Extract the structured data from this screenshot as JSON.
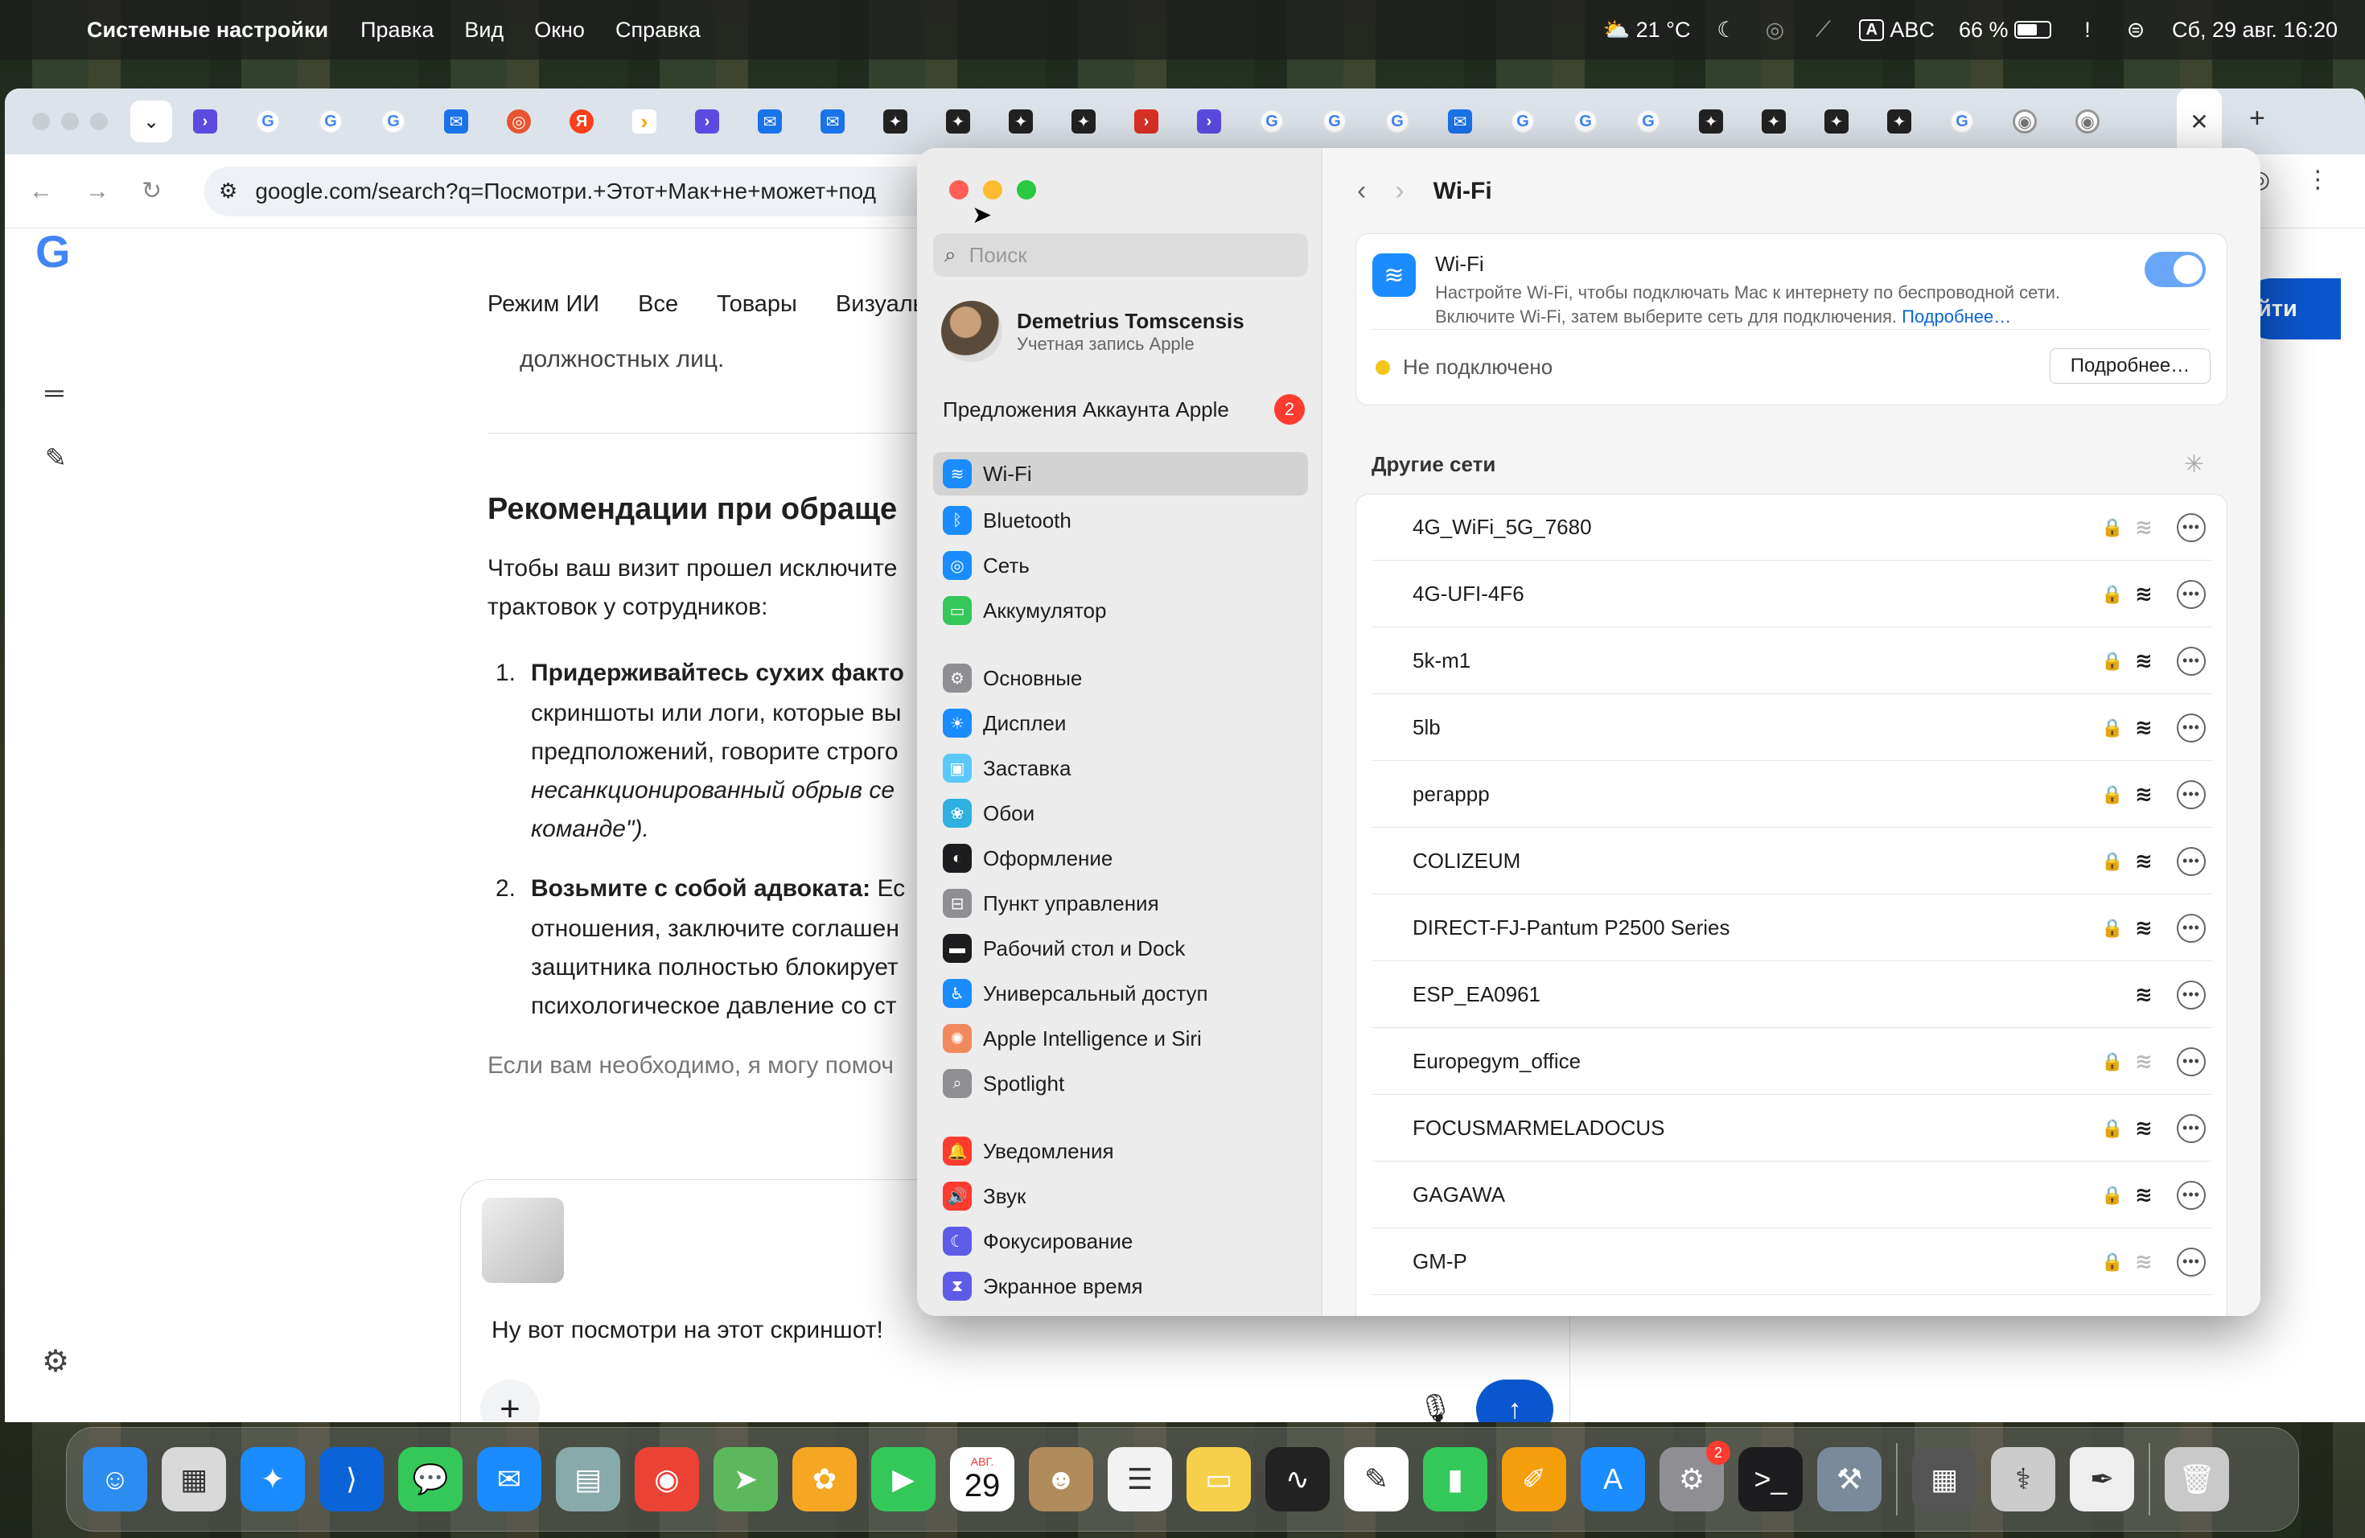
{
  "menubar": {
    "app": "Системные настройки",
    "items": [
      "Правка",
      "Вид",
      "Окно",
      "Справка"
    ],
    "weather": "21 °C",
    "input_badge": "A",
    "input_lang": "ABC",
    "battery": "66 %",
    "datetime": "Сб, 29 авг. 16:20"
  },
  "browser": {
    "url": "google.com/search?q=Посмотри.+Этот+Мак+не+может+под",
    "tabs_favicons": [
      "p",
      "g",
      "g",
      "g",
      "b",
      "o",
      "y",
      "a",
      "p",
      "b",
      "b",
      "d",
      "d",
      "d",
      "d",
      "r",
      "p",
      "g",
      "g",
      "g",
      "b",
      "g",
      "g",
      "g",
      "d",
      "d",
      "d",
      "d",
      "g",
      "c",
      "c"
    ]
  },
  "google": {
    "tabs": [
      "Режим ИИ",
      "Все",
      "Товары",
      "Визуаль"
    ],
    "frag_top": "должностных лиц.",
    "heading": "Рекомендации при обраще",
    "para1": "Чтобы ваш визит прошел исключите",
    "para2": "трактовок у сотрудников:",
    "n1": "1.",
    "b1": "Придерживайтесь сухих факто",
    "l1a": "скриншоты или логи, которые вы",
    "l1b": "предположений, говорите строго",
    "l1c": "несанкционированный обрыв се",
    "l1d": "команде\").",
    "n2": "2.",
    "b2": "Возьмите с собой адвоката:",
    "b2rest": " Ес",
    "l2a": "отношения, заключите соглашен",
    "l2b": "защитника полностью блокирует",
    "l2c": "психологическое давление со ст",
    "frag_bottom": "Если вам необходимо, я могу помоч",
    "ask": "йти",
    "composer_msg": "Ну вот посмотри на этот скриншот! "
  },
  "settings": {
    "search_placeholder": "Поиск",
    "user_name": "Demetrius Tomscensis",
    "user_sub": "Учетная запись Apple",
    "suggest": "Предложения Аккаунта Apple",
    "suggest_badge": "2",
    "sidebar": [
      {
        "label": "Wi-Fi",
        "color": "#1a8cff",
        "glyph": "≋",
        "sel": true
      },
      {
        "label": "Bluetooth",
        "color": "#1a8cff",
        "glyph": "ᛒ"
      },
      {
        "label": "Сеть",
        "color": "#1a8cff",
        "glyph": "◎"
      },
      {
        "label": "Аккумулятор",
        "color": "#34c759",
        "glyph": "▭"
      },
      {
        "label": "Основные",
        "color": "#8e8e93",
        "glyph": "⚙"
      },
      {
        "label": "Дисплеи",
        "color": "#1a8cff",
        "glyph": "☀"
      },
      {
        "label": "Заставка",
        "color": "#5ac8fa",
        "glyph": "▣"
      },
      {
        "label": "Обои",
        "color": "#30b0e0",
        "glyph": "❀"
      },
      {
        "label": "Оформление",
        "color": "#1d1d1f",
        "glyph": "◐"
      },
      {
        "label": "Пункт управления",
        "color": "#8e8e93",
        "glyph": "⊟"
      },
      {
        "label": "Рабочий стол и Dock",
        "color": "#1d1d1f",
        "glyph": "▬"
      },
      {
        "label": "Универсальный доступ",
        "color": "#1a8cff",
        "glyph": "♿"
      },
      {
        "label": "Apple Intelligence и Siri",
        "color": "#f08a5d",
        "glyph": "✺"
      },
      {
        "label": "Spotlight",
        "color": "#8e8e93",
        "glyph": "⌕"
      },
      {
        "label": "Уведомления",
        "color": "#ff3b30",
        "glyph": "🔔"
      },
      {
        "label": "Звук",
        "color": "#ff3b30",
        "glyph": "🔊"
      },
      {
        "label": "Фокусирование",
        "color": "#5e5ce6",
        "glyph": "☾"
      },
      {
        "label": "Экранное время",
        "color": "#5e5ce6",
        "glyph": "⧗"
      }
    ],
    "title": "Wi-Fi",
    "wifi_label": "Wi-Fi",
    "wifi_desc1": "Настройте Wi-Fi, чтобы подключать Mac к интернету по беспроводной сети.",
    "wifi_desc2": "Включите Wi-Fi, затем выберите сеть для подключения.",
    "wifi_more_link": "Подробнее…",
    "status": "Не подключено",
    "more_button": "Подробнее…",
    "others_title": "Другие сети",
    "networks": [
      {
        "name": "4G_WiFi_5G_7680",
        "lock": true,
        "weak": true
      },
      {
        "name": "4G-UFI-4F6",
        "lock": true,
        "weak": false
      },
      {
        "name": "5k-m1",
        "lock": true,
        "weak": false
      },
      {
        "name": "5lb",
        "lock": true,
        "weak": false
      },
      {
        "name": "регаррр",
        "lock": true,
        "weak": false
      },
      {
        "name": "COLIZEUM",
        "lock": true,
        "weak": false
      },
      {
        "name": "DIRECT-FJ-Pantum P2500 Series",
        "lock": true,
        "weak": false
      },
      {
        "name": "ESP_EA0961",
        "lock": false,
        "weak": false
      },
      {
        "name": "Europegym_office",
        "lock": true,
        "weak": true
      },
      {
        "name": "FOCUSMARMELADOCUS",
        "lock": true,
        "weak": false
      },
      {
        "name": "GAGAWA",
        "lock": true,
        "weak": false
      },
      {
        "name": "GM-P",
        "lock": true,
        "weak": true
      }
    ]
  },
  "dock": {
    "calendar_month": "АВГ.",
    "calendar_day": "29",
    "settings_badge": "2",
    "apps": [
      {
        "n": "finder",
        "c": "#2d8cf0",
        "g": "☺"
      },
      {
        "n": "launchpad",
        "c": "#d9d9d9",
        "g": "▦"
      },
      {
        "n": "safari",
        "c": "#1a8cff",
        "g": "✦"
      },
      {
        "n": "vscode",
        "c": "#0a64d8",
        "g": "⟩"
      },
      {
        "n": "messages",
        "c": "#34c759",
        "g": "💬"
      },
      {
        "n": "mail",
        "c": "#1a8cff",
        "g": "✉"
      },
      {
        "n": "preview",
        "c": "#8aa",
        "g": "▤"
      },
      {
        "n": "chrome",
        "c": "#ea4335",
        "g": "◉"
      },
      {
        "n": "maps",
        "c": "#5cb85c",
        "g": "➤"
      },
      {
        "n": "photos",
        "c": "#f5a623",
        "g": "✿"
      },
      {
        "n": "facetime",
        "c": "#34c759",
        "g": "▶"
      },
      {
        "n": "calendar",
        "c": "#fff",
        "g": ""
      },
      {
        "n": "contacts",
        "c": "#b08b5b",
        "g": "☻"
      },
      {
        "n": "reminders",
        "c": "#f2f2f2",
        "g": "☰"
      },
      {
        "n": "notes",
        "c": "#f7d04b",
        "g": "▭"
      },
      {
        "n": "activity-monitor",
        "c": "#222",
        "g": "∿"
      },
      {
        "n": "freeform",
        "c": "#fff",
        "g": "✎"
      },
      {
        "n": "numbers",
        "c": "#34c759",
        "g": "▮"
      },
      {
        "n": "pages",
        "c": "#f59e0b",
        "g": "✐"
      },
      {
        "n": "app-store",
        "c": "#1a8cff",
        "g": "A"
      },
      {
        "n": "system-settings",
        "c": "#8e8e93",
        "g": "⚙"
      },
      {
        "n": "terminal",
        "c": "#1d1d1f",
        "g": ">_"
      },
      {
        "n": "automator",
        "c": "#7a8a9a",
        "g": "⚒"
      }
    ],
    "apps2": [
      {
        "n": "calculator",
        "c": "#555",
        "g": "▦"
      },
      {
        "n": "disk-utility",
        "c": "#ccc",
        "g": "⚕"
      },
      {
        "n": "textedit",
        "c": "#eee",
        "g": "✒"
      }
    ]
  }
}
